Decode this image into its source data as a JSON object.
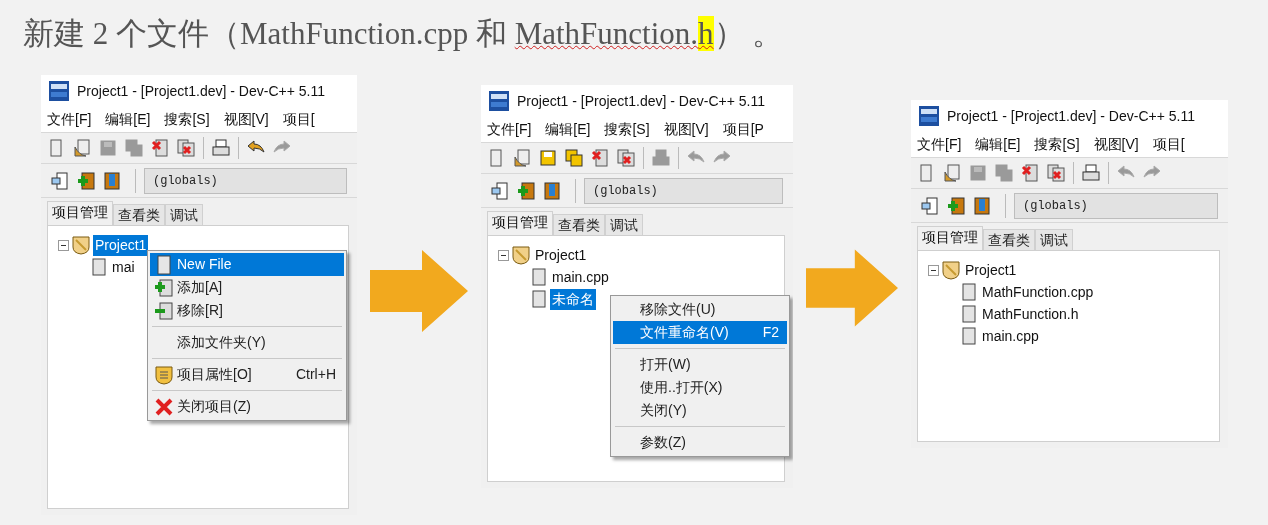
{
  "heading": {
    "parts": [
      {
        "text": "新建 2 个文件（MathFunction.cpp 和 ",
        "highlighted": false,
        "underlined": false
      },
      {
        "text": "MathFunction.",
        "highlighted": false,
        "underlined": true
      },
      {
        "text": "h",
        "highlighted": true,
        "underlined": true
      },
      {
        "text": "） 。",
        "highlighted": false,
        "underlined": false
      }
    ]
  },
  "windows": [
    {
      "title": "Project1 - [Project1.dev] - Dev-C++ 5.11",
      "menu": [
        "文件[F]",
        "编辑[E]",
        "搜索[S]",
        "视图[V]",
        "项目["
      ],
      "toolbar": [
        {
          "kind": "new",
          "disabled": false
        },
        {
          "kind": "open",
          "disabled": false
        },
        {
          "kind": "save",
          "disabled": true
        },
        {
          "kind": "saveall",
          "disabled": true
        },
        {
          "kind": "close",
          "disabled": false
        },
        {
          "kind": "closeall",
          "disabled": false
        },
        {
          "kind": "sep"
        },
        {
          "kind": "print",
          "disabled": false
        },
        {
          "kind": "sep"
        },
        {
          "kind": "undo",
          "disabled": false
        },
        {
          "kind": "redo",
          "disabled": true
        }
      ],
      "combo": "(globals)",
      "tabs": [
        {
          "label": "项目管理",
          "selected": true
        },
        {
          "label": "查看类",
          "selected": false
        },
        {
          "label": "调试",
          "selected": false
        }
      ],
      "tree": {
        "label": "Project1",
        "selected": true,
        "expanded": true,
        "children": [
          {
            "label": "mai",
            "selected": false
          }
        ]
      },
      "context_menu": {
        "items": [
          {
            "kind": "newfile",
            "label": "New File",
            "selected": true
          },
          {
            "kind": "add",
            "label": "添加[A]",
            "selected": false
          },
          {
            "kind": "remove",
            "label": "移除[R]",
            "selected": false
          },
          {
            "kind": "separator"
          },
          {
            "kind": "plain",
            "label": "添加文件夹(Y)",
            "selected": false
          },
          {
            "kind": "separator"
          },
          {
            "kind": "props",
            "label": "项目属性[O]",
            "shortcut": "Ctrl+H",
            "selected": false
          },
          {
            "kind": "separator"
          },
          {
            "kind": "close",
            "label": "关闭项目(Z)",
            "selected": false
          }
        ]
      }
    },
    {
      "title": "Project1 - [Project1.dev] - Dev-C++ 5.11",
      "menu": [
        "文件[F]",
        "编辑[E]",
        "搜索[S]",
        "视图[V]",
        "项目[P"
      ],
      "toolbar": [
        {
          "kind": "new",
          "disabled": false
        },
        {
          "kind": "open",
          "disabled": false
        },
        {
          "kind": "save",
          "disabled": false
        },
        {
          "kind": "saveall",
          "disabled": false
        },
        {
          "kind": "close",
          "disabled": false
        },
        {
          "kind": "closeall",
          "disabled": false
        },
        {
          "kind": "sep"
        },
        {
          "kind": "print",
          "disabled": true
        },
        {
          "kind": "sep"
        },
        {
          "kind": "undo",
          "disabled": true
        },
        {
          "kind": "redo",
          "disabled": true
        }
      ],
      "combo": "(globals)",
      "tabs": [
        {
          "label": "项目管理",
          "selected": true
        },
        {
          "label": "查看类",
          "selected": false
        },
        {
          "label": "调试",
          "selected": false
        }
      ],
      "tree": {
        "label": "Project1",
        "selected": false,
        "expanded": true,
        "children": [
          {
            "label": "main.cpp",
            "selected": false
          },
          {
            "label": "未命名",
            "selected": true
          }
        ]
      },
      "context_menu": {
        "items": [
          {
            "kind": "plain",
            "label": "移除文件(U)",
            "selected": false
          },
          {
            "kind": "plain",
            "label": "文件重命名(V)",
            "shortcut": "F2",
            "selected": true
          },
          {
            "kind": "separator"
          },
          {
            "kind": "plain",
            "label": "打开(W)",
            "selected": false
          },
          {
            "kind": "plain",
            "label": "使用..打开(X)",
            "selected": false
          },
          {
            "kind": "plain",
            "label": "关闭(Y)",
            "selected": false
          },
          {
            "kind": "separator"
          },
          {
            "kind": "plain",
            "label": "参数(Z)",
            "selected": false
          }
        ]
      }
    },
    {
      "title": "Project1 - [Project1.dev] - Dev-C++ 5.11",
      "menu": [
        "文件[F]",
        "编辑[E]",
        "搜索[S]",
        "视图[V]",
        "项目["
      ],
      "toolbar": [
        {
          "kind": "new",
          "disabled": false
        },
        {
          "kind": "open",
          "disabled": false
        },
        {
          "kind": "save",
          "disabled": true
        },
        {
          "kind": "saveall",
          "disabled": true
        },
        {
          "kind": "close",
          "disabled": false
        },
        {
          "kind": "closeall",
          "disabled": false
        },
        {
          "kind": "sep"
        },
        {
          "kind": "print",
          "disabled": false
        },
        {
          "kind": "sep"
        },
        {
          "kind": "undo",
          "disabled": true
        },
        {
          "kind": "redo",
          "disabled": true
        }
      ],
      "combo": "(globals)",
      "tabs": [
        {
          "label": "项目管理",
          "selected": true
        },
        {
          "label": "查看类",
          "selected": false
        },
        {
          "label": "调试",
          "selected": false
        }
      ],
      "tree": {
        "label": "Project1",
        "selected": false,
        "expanded": true,
        "children": [
          {
            "label": "MathFunction.cpp",
            "selected": false
          },
          {
            "label": "MathFunction.h",
            "selected": false
          },
          {
            "label": "main.cpp",
            "selected": false
          }
        ]
      }
    }
  ]
}
